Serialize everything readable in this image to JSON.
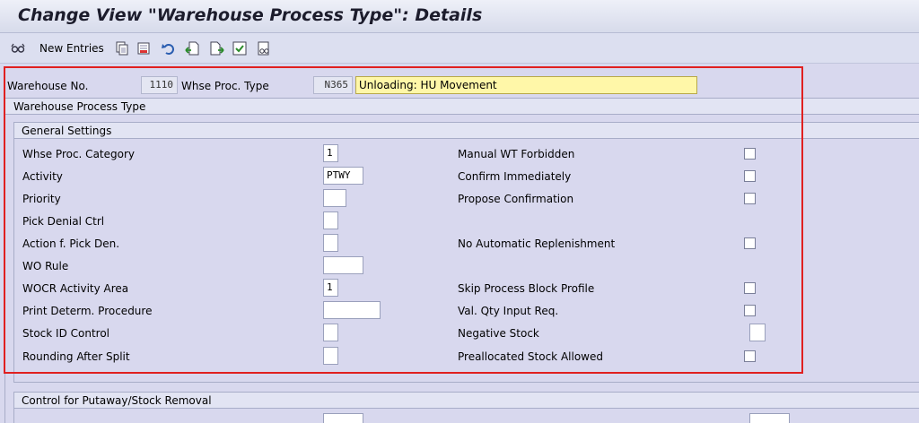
{
  "title": "Change View \"Warehouse Process Type\": Details",
  "toolbar": {
    "new_entries_label": "New Entries",
    "icons": [
      "glasses-icon",
      "copy-icon",
      "delete-icon",
      "undo-icon",
      "previous-entry-icon",
      "next-entry-icon",
      "select-all-icon",
      "transport-icon"
    ]
  },
  "header": {
    "warehouse_label": "Warehouse No.",
    "warehouse_value": "1110",
    "proc_type_label": "Whse Proc. Type",
    "proc_type_value": "N365",
    "proc_type_desc": "Unloading: HU Movement"
  },
  "section_title": "Warehouse Process Type",
  "general": {
    "title": "General Settings",
    "left": [
      {
        "label": "Whse Proc. Category",
        "value": "1"
      },
      {
        "label": "Activity",
        "value": "PTWY"
      },
      {
        "label": "Priority",
        "value": ""
      },
      {
        "label": "Pick Denial Ctrl",
        "value": ""
      },
      {
        "label": "Action f. Pick Den.",
        "value": ""
      },
      {
        "label": "WO Rule",
        "value": ""
      },
      {
        "label": "WOCR Activity Area",
        "value": "1"
      },
      {
        "label": "Print Determ. Procedure",
        "value": ""
      },
      {
        "label": "Stock ID Control",
        "value": ""
      },
      {
        "label": "Rounding After Split",
        "value": ""
      }
    ],
    "right": [
      {
        "label": "Manual WT Forbidden",
        "checked": false
      },
      {
        "label": "Confirm Immediately",
        "checked": false
      },
      {
        "label": "Propose Confirmation",
        "checked": false
      },
      {
        "label": "No Automatic Replenishment",
        "checked": false
      },
      {
        "label": "Skip Process Block Profile",
        "checked": false
      },
      {
        "label": "Val. Qty Input Req.",
        "checked": false
      },
      {
        "label": "Negative Stock",
        "value": ""
      },
      {
        "label": "Preallocated Stock Allowed",
        "checked": false
      }
    ]
  },
  "putaway": {
    "title": "Control for Putaway/Stock Removal"
  },
  "colors": {
    "background": "#d8d8ee",
    "highlight": "#fff7a8",
    "annotation": "#e02020"
  }
}
